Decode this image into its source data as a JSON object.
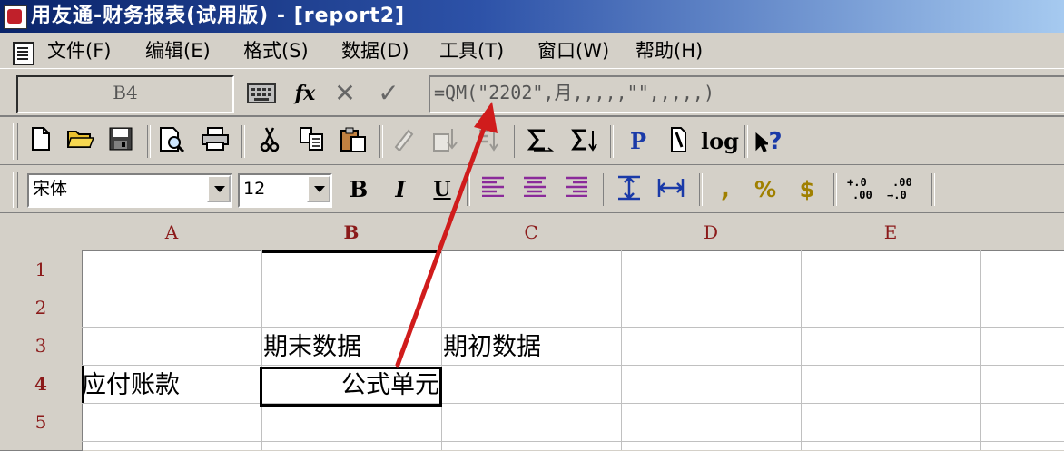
{
  "window": {
    "title": "用友通-财务报表(试用版) - [report2]"
  },
  "menu": [
    {
      "label": "文件(F)"
    },
    {
      "label": "编辑(E)"
    },
    {
      "label": "格式(S)"
    },
    {
      "label": "数据(D)"
    },
    {
      "label": "工具(T)"
    },
    {
      "label": "窗口(W)"
    },
    {
      "label": "帮助(H)"
    }
  ],
  "formula_bar": {
    "cell_ref": "B4",
    "fx_label": "fx",
    "cancel_glyph": "✕",
    "confirm_glyph": "✓",
    "formula": "=QM(\"2202\",月,,,,,\"\",,,,,)"
  },
  "toolbar2": {
    "font_name": "宋体",
    "font_size": "12",
    "bold": "B",
    "italic": "I",
    "underline": "U",
    "comma": ",",
    "percent": "%",
    "currency": "$",
    "inc_decimal": "+.0 .00",
    "dec_decimal": ".00 →.0"
  },
  "toolbar1": {
    "p": "P",
    "log": "log",
    "help": "?"
  },
  "sheet": {
    "columns": [
      "A",
      "B",
      "C",
      "D",
      "E"
    ],
    "rows": [
      "1",
      "2",
      "3",
      "4",
      "5"
    ],
    "cells": {
      "B3": "期末数据",
      "C3": "期初数据",
      "A4": "应付账款",
      "B4": "公式单元"
    }
  },
  "colors": {
    "arrow": "#d01c1c",
    "header_text": "#8b1a1a",
    "chrome": "#d4d0c8"
  }
}
